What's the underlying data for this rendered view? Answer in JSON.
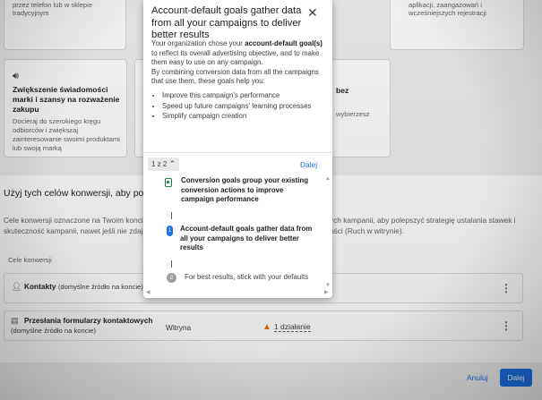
{
  "cards": {
    "left_top_fragment": "przez telefon lub w sklepie tradycyjnym",
    "right_top_fragment": "aplikacji, zaangażowań i wcześniejszych rejestracji",
    "awareness": {
      "icon": "megaphone-icon",
      "title": "Zwiększenie świadomości marki i szansy na rozważenie zakupu",
      "description": "Docieraj do szerokiego kręgu odbiorców i zwiększaj zainteresowanie swoimi produktami lub swoją marką"
    },
    "right_mid_fragment_title": "bez",
    "right_mid_fragment_desc": "wybierzesz"
  },
  "section": {
    "title": "Użyj tych celów konwersji, aby polepsz",
    "description_left": "Cele konwersji oznaczone na Twoim koncie",
    "description_left_2": "skuteczność kampanii, nawet jeśli nie zdają",
    "description_right": "ych kampanii, aby polepszyć strategię ustalania stawek i",
    "description_right_2": "ości (Ruch w witrynie).",
    "column_label": "Cele konwersji"
  },
  "goals": [
    {
      "icon": "person-contact-icon",
      "name": "Kontakty",
      "subtitle": "(domyślne źródło na koncie)",
      "source": "",
      "warning": ""
    },
    {
      "icon": "form-icon",
      "name": "Przesłania formularzy kontaktowych",
      "subtitle": "(domyślne źródło na koncie)",
      "source": "Witryna",
      "warning": "1 działanie"
    }
  ],
  "footer": {
    "cancel_label": "Anuluj",
    "next_label": "Dalej"
  },
  "popup": {
    "title": "Account-default goals gather data from all your campaigns to deliver better results",
    "intro_pre": "Your organization chose your ",
    "intro_bold": "account-default goal(s)",
    "intro_post": " to reflect its overall advertising objective, and to make them easy to use on any campaign.",
    "intro2": "By combining conversion data from all the campaigns that use them, these goals help you:",
    "bullets": [
      "Improve this campaign's performance",
      "Speed up future campaigns' learning processes",
      "Simplify campaign creation"
    ],
    "counter": "1 z 2",
    "next": "Dalej",
    "steps": [
      {
        "marker": "",
        "text": "Conversion goals group your existing conversion actions to improve campaign performance"
      },
      {
        "marker": "1",
        "text": "Account-default goals gather data from all your campaigns to deliver better results"
      },
      {
        "marker": "2",
        "text": "For best results, stick with your defaults"
      }
    ]
  },
  "colors": {
    "accent": "#1a73e8",
    "warning": "#e37400",
    "success": "#188038"
  }
}
